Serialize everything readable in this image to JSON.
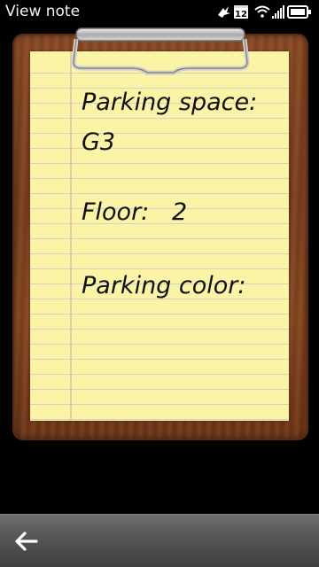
{
  "status_bar": {
    "title": "View note",
    "calendar_day": "12"
  },
  "note": {
    "line1": "Parking space:",
    "line2": "G3",
    "line3": "Floor:   2",
    "line4": "Parking color:"
  },
  "colors": {
    "paper": "#fbf3a6",
    "wood": "#7b3f1c",
    "toolbar": "#555555"
  },
  "icons": {
    "status": [
      "notification-icon",
      "calendar-icon",
      "wifi-icon",
      "signal-icon",
      "battery-icon"
    ],
    "toolbar": [
      "back-arrow-icon"
    ]
  }
}
